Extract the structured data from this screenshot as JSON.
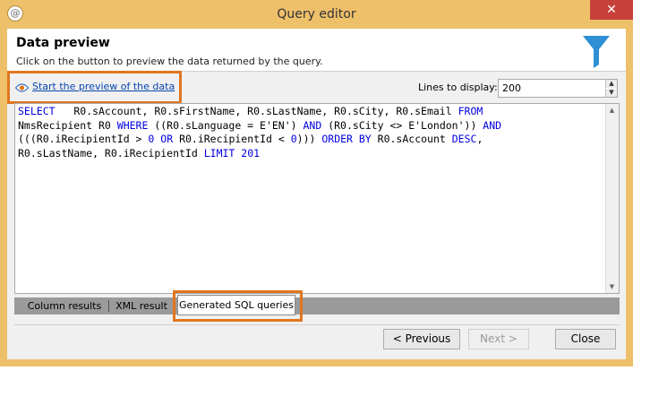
{
  "window": {
    "title": "Query editor",
    "app_icon": "@",
    "close_glyph": "✕"
  },
  "header": {
    "title": "Data preview",
    "subtitle": "Click on the button to preview the data returned by the query.",
    "icon": "filter-icon"
  },
  "toolbar": {
    "preview_link": "Start the preview of the data",
    "lines_label": "Lines to display:",
    "lines_value": "200"
  },
  "sql": {
    "line1": [
      "SELECT",
      "   R0.sAccount, R0.sFirstName, R0.sLastName, R0.sCity, R0.sEmail ",
      "FROM"
    ],
    "line2": [
      "NmsRecipient R0 ",
      "WHERE",
      " ((R0.sLanguage = E'EN') ",
      "AND",
      " (R0.sCity <> E'London')) ",
      "AND"
    ],
    "line3": [
      "(((R0.iRecipientId > ",
      "0",
      " ",
      "OR",
      " R0.iRecipientId < ",
      "0",
      "))) ",
      "ORDER BY",
      " R0.sAccount ",
      "DESC",
      ","
    ],
    "line4": [
      "R0.sLastName, R0.iRecipientId ",
      "LIMIT",
      " ",
      "201"
    ]
  },
  "tabs": [
    {
      "label": "Column results"
    },
    {
      "label": "XML result"
    },
    {
      "label": "Generated SQL queries"
    }
  ],
  "footer": {
    "previous": "< Previous",
    "next": "Next >",
    "close": "Close"
  },
  "colors": {
    "title_bar": "#eec06a",
    "highlight": "#e0761f",
    "keyword": "#0000e0",
    "link": "#0645ad"
  }
}
